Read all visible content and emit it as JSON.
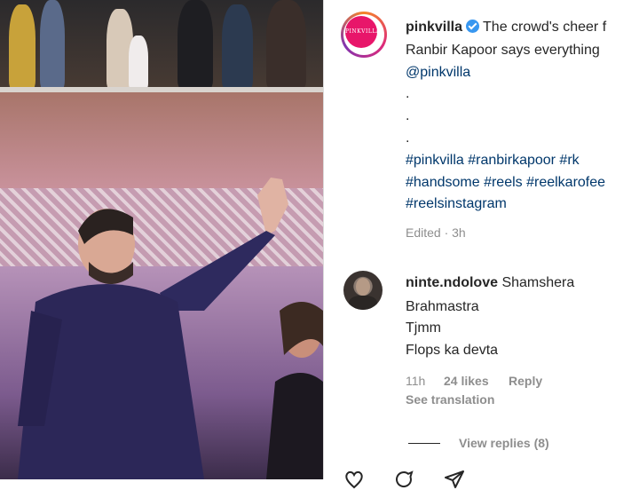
{
  "post": {
    "username": "pinkvilla",
    "caption_line1": "The crowd's cheer f",
    "caption_line2": "Ranbir Kapoor says everything",
    "mention": "@pinkvilla",
    "dot1": ".",
    "dot2": ".",
    "dot3": ".",
    "hashtags_line1": "#pinkvilla #ranbirkapoor #rk",
    "hashtags_line2": "#handsome #reels #reelkarofee",
    "hashtags_line3": "#reelsinstagram",
    "meta": "Edited · 3h",
    "brand_logo_text": "PINKVILLA"
  },
  "comment": {
    "username": "ninte.ndolove",
    "line1": "Shamshera",
    "line2": "Brahmastra",
    "line3": "Tjmm",
    "line4": "Flops ka devta",
    "time": "11h",
    "likes": "24 likes",
    "reply": "Reply",
    "see_translation": "See translation",
    "view_replies": "View replies (8)"
  },
  "icons": [
    "verified-badge-icon",
    "heart-icon",
    "comment-icon",
    "share-icon"
  ]
}
